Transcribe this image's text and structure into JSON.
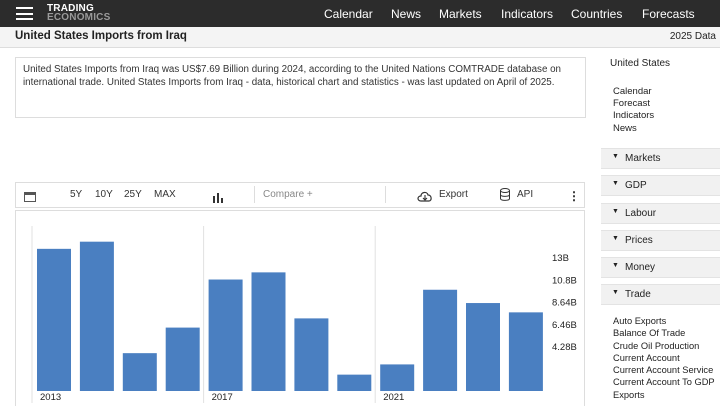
{
  "header": {
    "logo_line1": "TRADING",
    "logo_line2": "ECONOMICS",
    "nav": [
      "Calendar",
      "News",
      "Markets",
      "Indicators",
      "Countries",
      "Forecasts"
    ]
  },
  "titlebar": {
    "title": "United States Imports from Iraq",
    "right": "2025 Data"
  },
  "description": "United States Imports from Iraq was US$7.69 Billion during 2024, according to the United Nations COMTRADE database on international trade. United States Imports from Iraq - data, historical chart and statistics - was last updated on April of 2025.",
  "toolbar": {
    "ranges": [
      "5Y",
      "10Y",
      "25Y",
      "MAX"
    ],
    "compare_placeholder": "Compare +",
    "export_label": "Export",
    "api_label": "API"
  },
  "chart_data": {
    "type": "bar",
    "color": "#4a7fc1",
    "x": [
      2013,
      2014,
      2015,
      2016,
      2017,
      2018,
      2019,
      2020,
      2021,
      2022,
      2023,
      2024
    ],
    "values": [
      13.9,
      14.6,
      3.7,
      6.2,
      10.9,
      11.6,
      7.1,
      1.6,
      2.6,
      9.9,
      8.6,
      7.69
    ],
    "x_tick_labels": [
      "2013",
      "2017",
      "2021"
    ],
    "y_ticks": [
      4.28,
      6.46,
      8.64,
      10.8,
      13
    ],
    "y_tick_labels": [
      "4.28B",
      "6.46B",
      "8.64B",
      "10.8B",
      "13B"
    ],
    "ylim": [
      0,
      17.6
    ],
    "grid": "vertical lines at 2013, 2017, 2021",
    "y_axis_side": "right"
  },
  "sidebar": {
    "title": "United States",
    "links": [
      "Calendar",
      "Forecast",
      "Indicators",
      "News"
    ],
    "sections": [
      "Markets",
      "GDP",
      "Labour",
      "Prices",
      "Money",
      "Trade"
    ],
    "trade_links": [
      "Auto Exports",
      "Balance Of Trade",
      "Crude Oil Production",
      "Current Account",
      "Current Account Service",
      "Current Account To GDP",
      "Exports"
    ]
  }
}
